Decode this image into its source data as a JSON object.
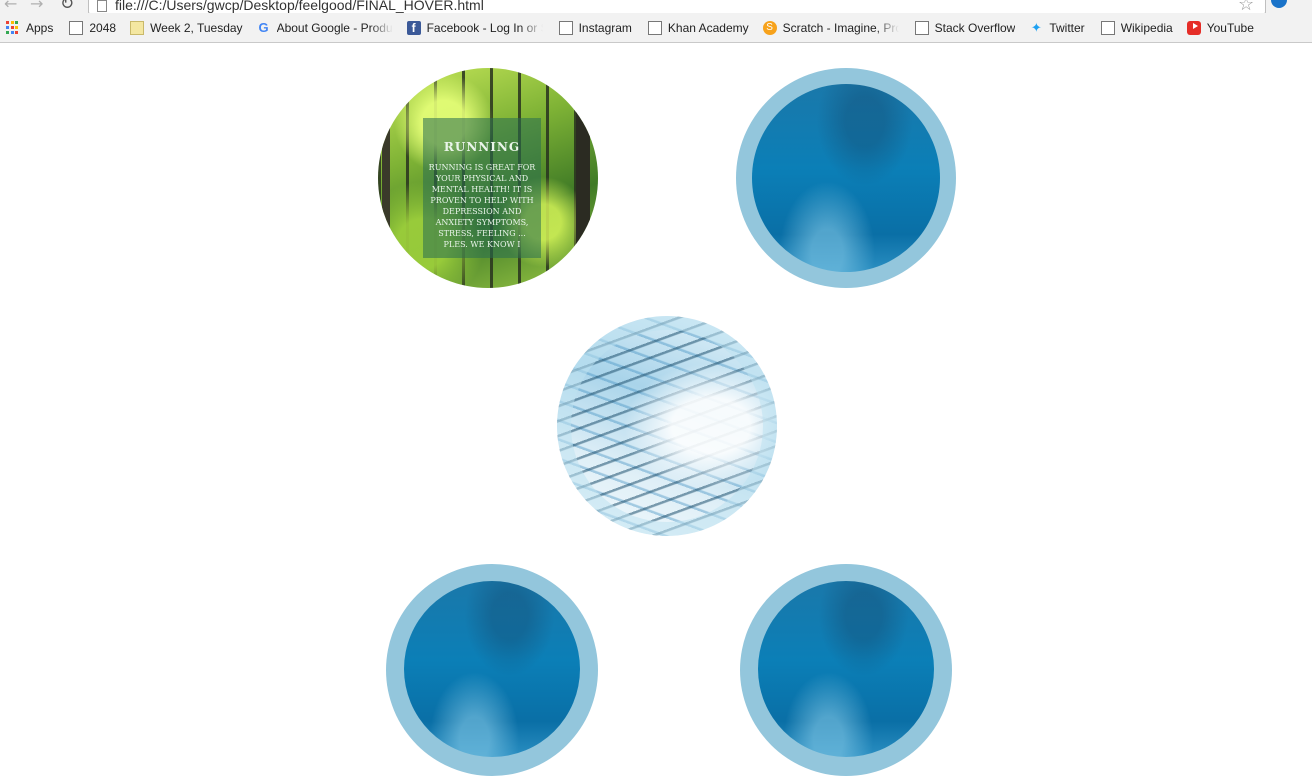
{
  "browser": {
    "url": "file:///C:/Users/gwcp/Desktop/feelgood/FINAL_HOVER.html",
    "bookmarks": [
      {
        "label": "Apps",
        "icon": "apps-grid-icon"
      },
      {
        "label": "2048",
        "icon": "page-icon"
      },
      {
        "label": "Week 2, Tuesday",
        "icon": "calendar-icon"
      },
      {
        "label": "About Google - Produ",
        "icon": "google-icon"
      },
      {
        "label": "Facebook - Log In or S",
        "icon": "facebook-icon"
      },
      {
        "label": "Instagram",
        "icon": "page-icon"
      },
      {
        "label": "Khan Academy",
        "icon": "page-icon"
      },
      {
        "label": "Scratch - Imagine, Pro",
        "icon": "scratch-icon"
      },
      {
        "label": "Stack Overflow",
        "icon": "page-icon"
      },
      {
        "label": "Twitter",
        "icon": "twitter-icon"
      },
      {
        "label": "Wikipedia",
        "icon": "page-icon"
      },
      {
        "label": "YouTube",
        "icon": "youtube-icon"
      }
    ]
  },
  "page": {
    "running": {
      "title": "RUNNING",
      "body": "RUNNING IS GREAT FOR YOUR PHYSICAL AND MENTAL HEALTH! IT IS PROVEN TO HELP WITH DEPRESSION AND ANXIETY SYMPTOMS, STRESS, FEELING ... PLES. WE KNOW I"
    }
  },
  "colors": {
    "ring": "#93c6dc",
    "water": "#0b7fb7"
  }
}
